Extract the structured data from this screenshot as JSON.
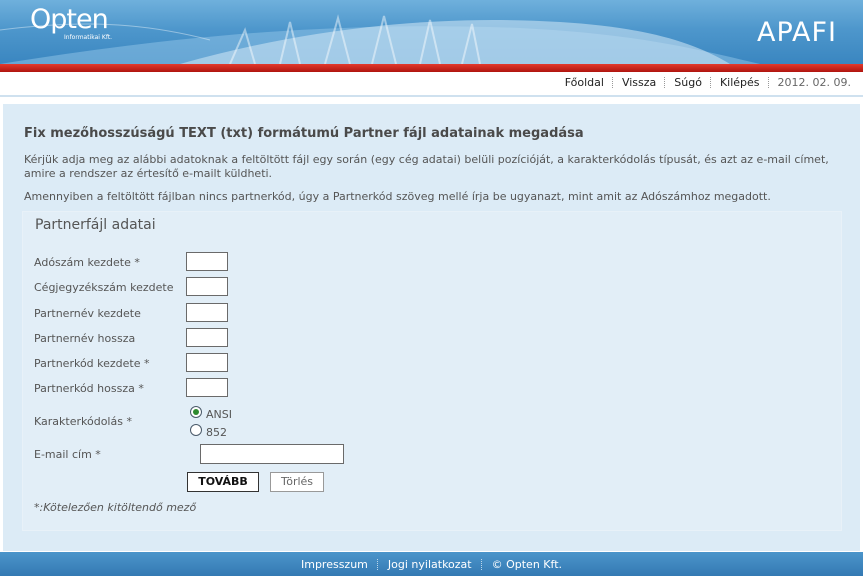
{
  "header": {
    "logo": "Opten",
    "logo_sub": "Informatikai Kft.",
    "app_name": "APAFI"
  },
  "nav": {
    "home": "Főoldal",
    "back": "Vissza",
    "help": "Súgó",
    "logout": "Kilépés",
    "date": "2012. 02. 09."
  },
  "page": {
    "title": "Fix mezőhosszúságú TEXT (txt) formátumú Partner fájl adatainak megadása",
    "intro_1": "Kérjük adja meg az alábbi adatoknak a feltöltött fájl egy során (egy cég adatai) belüli pozícióját, a karakterkódolás típusát, és azt az e-mail címet, amire a rendszer az értesítő e-mailt küldheti.",
    "intro_2": "Amennyiben a feltöltött fájlban nincs partnerkód, úgy a Partnerkód szöveg mellé írja be ugyanazt, mint amit az Adószámhoz megadott."
  },
  "form": {
    "title": "Partnerfájl adatai",
    "fields": {
      "tax_start": "Adószám kezdete *",
      "reg_start": "Cégjegyzékszám kezdete",
      "name_start": "Partnernév kezdete",
      "name_length": "Partnernév hossza",
      "code_start": "Partnerkód kezdete *",
      "code_length": "Partnerkód hossza *"
    },
    "encoding_label": "Karakterkódolás *",
    "encoding_options": [
      "ANSI",
      "852"
    ],
    "encoding_selected": "ANSI",
    "email_label": "E-mail cím *",
    "email_value": "",
    "next_button": "TOVÁBB",
    "clear_button": "Törlés",
    "required_note": "*:Kötelezően kitöltendő mező"
  },
  "footer": {
    "imprint": "Impresszum",
    "legal": "Jogi nyilatkozat",
    "copyright": "© Opten Kft."
  },
  "colors": {
    "header_blue": "#4e97cc",
    "accent_red": "#c0211a",
    "content_bg": "#dcebf6",
    "footer_blue": "#3f86bf"
  }
}
